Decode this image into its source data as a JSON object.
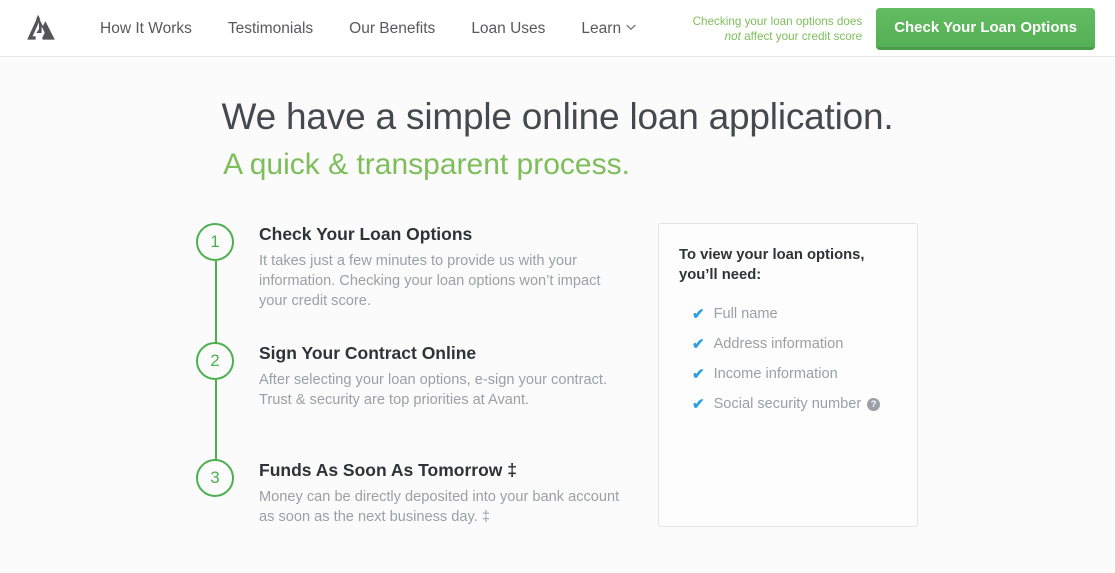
{
  "nav": {
    "logo_icon": "avant-logo-icon",
    "links": [
      {
        "label": "How It Works"
      },
      {
        "label": "Testimonials"
      },
      {
        "label": "Our Benefits"
      },
      {
        "label": "Loan Uses"
      },
      {
        "label": "Learn",
        "has_dropdown": true,
        "chevron_icon": "chevron-down-icon"
      }
    ],
    "disclaimer": {
      "line1_prefix": "Checking your loan options does",
      "line2_emphasis": "not",
      "line2_rest": " affect your credit score"
    },
    "cta_label": "Check Your Loan Options"
  },
  "hero": {
    "headline": "We have a simple online loan application.",
    "subheadline": "A quick & transparent process."
  },
  "steps": [
    {
      "number": "1",
      "title": "Check Your Loan Options",
      "description": "It takes just a few minutes to provide us with your information. Checking your loan options won’t impact your credit score."
    },
    {
      "number": "2",
      "title": "Sign Your Contract Online",
      "description": "After selecting your loan options, e-sign your contract. Trust & security are top priorities at Avant."
    },
    {
      "number": "3",
      "title": "Funds As Soon As Tomorrow ‡",
      "description": "Money can be directly deposited into your bank account as soon as the next business day. ‡"
    }
  ],
  "requirements_card": {
    "title": "To view your loan options, you’ll need:",
    "check_icon": "check-icon",
    "check_glyph": "✔",
    "items": [
      {
        "label": "Full name"
      },
      {
        "label": "Address information"
      },
      {
        "label": "Income information"
      },
      {
        "label": "Social security number",
        "help_icon": "help-circle-icon",
        "help_glyph": "?"
      }
    ]
  },
  "colors": {
    "brand_green": "#7ebe5a",
    "cta_green": "#5cb85c",
    "step_green": "#4caf50",
    "check_blue": "#2e9fe0",
    "body_gray": "#9aa0a6",
    "heading_dark": "#45484d",
    "page_bg": "#fbfbfb"
  }
}
